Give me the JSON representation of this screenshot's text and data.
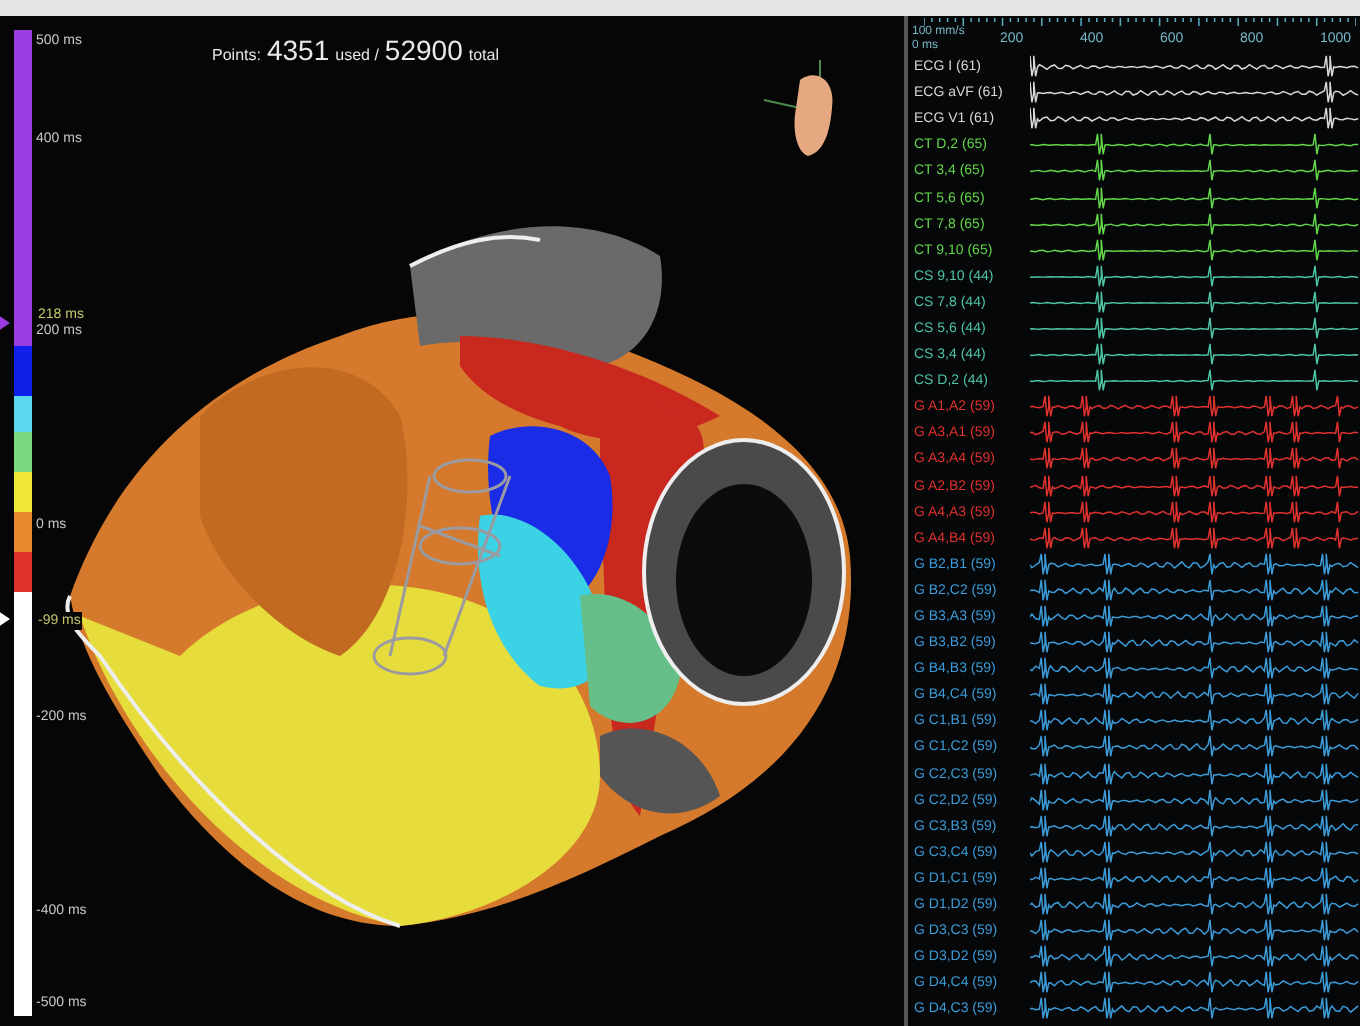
{
  "map": {
    "points_label": "Points:",
    "used_count": "4351",
    "used_label": "used /",
    "total_count": "52900",
    "total_label": "total"
  },
  "scale": {
    "labels": [
      {
        "text": "500 ms",
        "kind": "tick"
      },
      {
        "text": "400 ms",
        "kind": "tick"
      },
      {
        "text": "218 ms",
        "kind": "marker"
      },
      {
        "text": "200 ms",
        "kind": "tick"
      },
      {
        "text": "0 ms",
        "kind": "tick"
      },
      {
        "text": "-99 ms",
        "kind": "marker"
      },
      {
        "text": "-200 ms",
        "kind": "tick"
      },
      {
        "text": "-400 ms",
        "kind": "tick"
      },
      {
        "text": "-500 ms",
        "kind": "tick"
      }
    ]
  },
  "timeline": {
    "speed": "100 mm/s",
    "origin": "0 ms",
    "ticks": [
      "200",
      "400",
      "600",
      "800",
      "1000"
    ]
  },
  "channels": [
    {
      "label": "ECG I (61)",
      "kind": "ecg",
      "color": "#d8d8d8"
    },
    {
      "label": "ECG aVF (61)",
      "kind": "ecg",
      "color": "#d8d8d8"
    },
    {
      "label": "ECG V1 (61)",
      "kind": "ecg",
      "color": "#d8d8d8"
    },
    {
      "label": "CT D,2 (65)",
      "kind": "ct",
      "color": "#62d54a"
    },
    {
      "label": "CT 3,4 (65)",
      "kind": "ct",
      "color": "#62d54a"
    },
    {
      "label": "CT 5,6 (65)",
      "kind": "ct",
      "color": "#62d54a"
    },
    {
      "label": "CT 7,8 (65)",
      "kind": "ct",
      "color": "#62d54a"
    },
    {
      "label": "CT 9,10 (65)",
      "kind": "ct",
      "color": "#62d54a"
    },
    {
      "label": "CS 9,10 (44)",
      "kind": "cs",
      "color": "#4fc3a6"
    },
    {
      "label": "CS 7,8 (44)",
      "kind": "cs",
      "color": "#4fc3a6"
    },
    {
      "label": "CS 5,6 (44)",
      "kind": "cs",
      "color": "#4fc3a6"
    },
    {
      "label": "CS 3,4 (44)",
      "kind": "cs",
      "color": "#4fc3a6"
    },
    {
      "label": "CS D,2 (44)",
      "kind": "cs",
      "color": "#4fc3a6"
    },
    {
      "label": "G A1,A2 (59)",
      "kind": "ga",
      "color": "#e0322e"
    },
    {
      "label": "G A3,A1 (59)",
      "kind": "ga",
      "color": "#e0322e"
    },
    {
      "label": "G A3,A4 (59)",
      "kind": "ga",
      "color": "#e0322e"
    },
    {
      "label": "G A2,B2 (59)",
      "kind": "ga",
      "color": "#e0322e"
    },
    {
      "label": "G A4,A3 (59)",
      "kind": "ga",
      "color": "#e0322e"
    },
    {
      "label": "G A4,B4 (59)",
      "kind": "ga",
      "color": "#e0322e"
    },
    {
      "label": "G B2,B1 (59)",
      "kind": "gb",
      "color": "#3d9bd8"
    },
    {
      "label": "G B2,C2 (59)",
      "kind": "gb",
      "color": "#3d9bd8"
    },
    {
      "label": "G B3,A3 (59)",
      "kind": "gb",
      "color": "#3d9bd8"
    },
    {
      "label": "G B3,B2 (59)",
      "kind": "gb",
      "color": "#3d9bd8"
    },
    {
      "label": "G B4,B3 (59)",
      "kind": "gb",
      "color": "#3d9bd8"
    },
    {
      "label": "G B4,C4 (59)",
      "kind": "gb",
      "color": "#3d9bd8"
    },
    {
      "label": "G C1,B1 (59)",
      "kind": "gb",
      "color": "#3d9bd8"
    },
    {
      "label": "G C1,C2 (59)",
      "kind": "gb",
      "color": "#3d9bd8"
    },
    {
      "label": "G C2,C3 (59)",
      "kind": "gb",
      "color": "#3d9bd8"
    },
    {
      "label": "G C2,D2 (59)",
      "kind": "gb",
      "color": "#3d9bd8"
    },
    {
      "label": "G C3,B3 (59)",
      "kind": "gb",
      "color": "#3d9bd8"
    },
    {
      "label": "G C3,C4 (59)",
      "kind": "gb",
      "color": "#3d9bd8"
    },
    {
      "label": "G D1,C1 (59)",
      "kind": "gb",
      "color": "#3d9bd8"
    },
    {
      "label": "G D1,D2 (59)",
      "kind": "gb",
      "color": "#3d9bd8"
    },
    {
      "label": "G D3,C3 (59)",
      "kind": "gb",
      "color": "#3d9bd8"
    },
    {
      "label": "G D3,D2 (59)",
      "kind": "gb",
      "color": "#3d9bd8"
    },
    {
      "label": "G D4,C4 (59)",
      "kind": "gb",
      "color": "#3d9bd8"
    },
    {
      "label": "G D4,C3 (59)",
      "kind": "gb",
      "color": "#3d9bd8"
    }
  ]
}
